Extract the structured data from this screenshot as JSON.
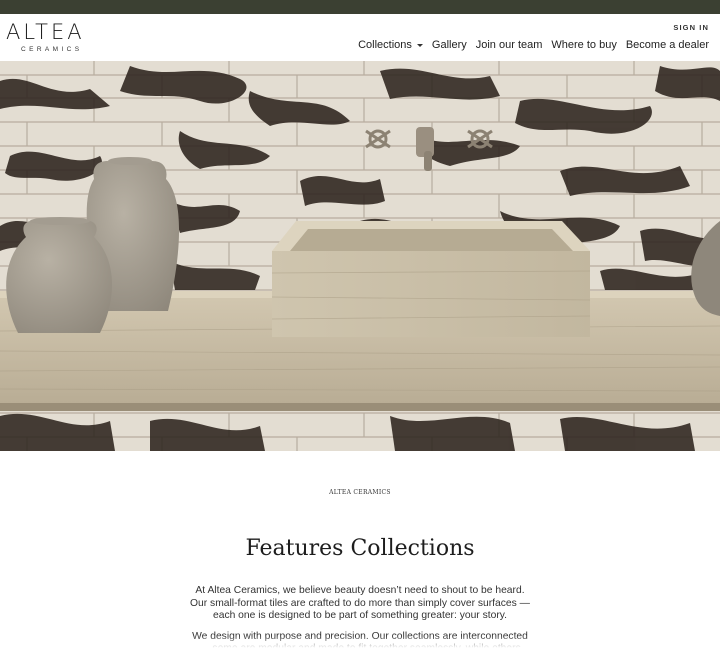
{
  "header": {
    "brand": "ALTEA",
    "brand_sub": "CERAMICS",
    "sign_in": "SIGN IN",
    "nav": [
      {
        "label": "Collections",
        "has_dropdown": true
      },
      {
        "label": "Gallery"
      },
      {
        "label": "Join our team"
      },
      {
        "label": "Where to buy"
      },
      {
        "label": "Become a dealer"
      }
    ]
  },
  "hero": {
    "slide_count": 6,
    "active_slide": 1
  },
  "colors": {
    "top_bar": "#3b4032",
    "marble_vein": "#2e241e",
    "travertine": "#c9bea7"
  },
  "section": {
    "eyebrow": "ALTEA CERAMICS",
    "title": "Features Collections",
    "paragraphs": [
      "At Altea Ceramics, we believe beauty doesn’t need to shout to be heard. Our small-format tiles are crafted to do more than simply cover surfaces — each one is designed to be part of something greater: your story.",
      "We design with purpose and precision. Our collections are interconnected — some are modular and made to fit together seamlessly, while others"
    ]
  }
}
